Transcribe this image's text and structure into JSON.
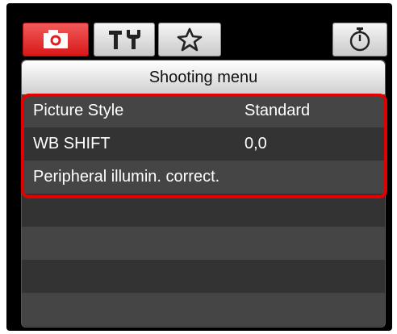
{
  "tabs": [
    {
      "id": "shooting",
      "icon": "camera-icon",
      "active": true
    },
    {
      "id": "setup",
      "icon": "wrench-icon",
      "active": false
    },
    {
      "id": "my-menu",
      "icon": "star-icon",
      "active": false
    },
    {
      "id": "timer",
      "icon": "timer-icon",
      "active": false
    }
  ],
  "menu": {
    "title": "Shooting menu",
    "items": [
      {
        "label": "Picture Style",
        "value": "Standard"
      },
      {
        "label": "WB SHIFT",
        "value": "0,0"
      },
      {
        "label": "Peripheral illumin. correct.",
        "value": ""
      }
    ]
  },
  "colors": {
    "active_tab": "#e02020",
    "highlight_border": "#e30000",
    "panel_bg": "#3a3a3a"
  }
}
